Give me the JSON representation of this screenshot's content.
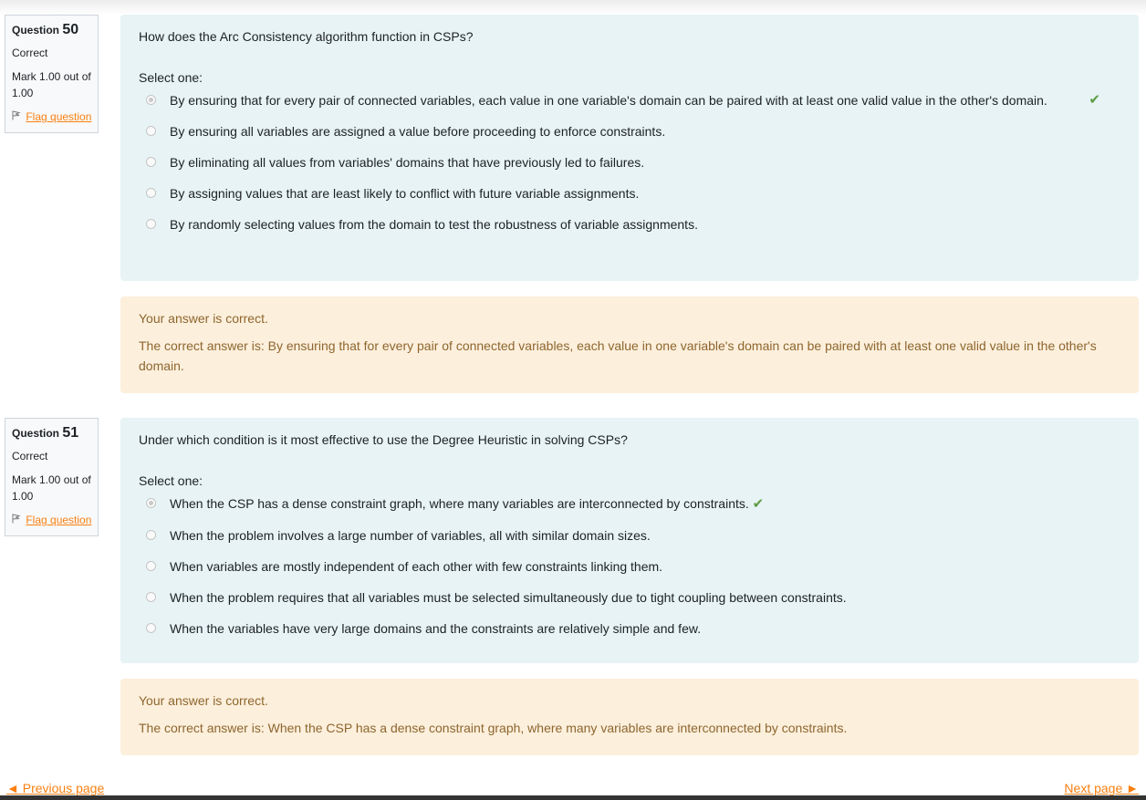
{
  "questions": [
    {
      "label": "Question",
      "number": "50",
      "state": "Correct",
      "grade": "Mark 1.00 out of 1.00",
      "flag": "Flag question",
      "text": "How does the Arc Consistency algorithm function in CSPs?",
      "prompt": "Select one:",
      "options": [
        "By ensuring that for every pair of connected variables, each value in one variable's domain can be paired with at least one valid value in the other's domain.",
        "By ensuring all variables are assigned a value before proceeding to enforce constraints.",
        "By eliminating all values from variables' domains that have previously led to failures.",
        "By assigning values that are least likely to conflict with future variable assignments.",
        "By randomly selecting values from the domain to test the robustness of variable assignments."
      ],
      "feedback": "Your answer is correct.",
      "right_answer": "The correct answer is: By ensuring that for every pair of connected variables, each value in one variable's domain can be paired with at least one valid value in the other's domain."
    },
    {
      "label": "Question",
      "number": "51",
      "state": "Correct",
      "grade": "Mark 1.00 out of 1.00",
      "flag": "Flag question",
      "text": "Under which condition is it most effective to use the Degree Heuristic in solving CSPs?",
      "prompt": "Select one:",
      "options": [
        "When the CSP has a dense constraint graph, where many variables are interconnected by constraints.",
        "When the problem involves a large number of variables, all with similar domain sizes.",
        "When variables are mostly independent of each other with few constraints linking them.",
        "When the problem requires that all variables must be selected simultaneously due to tight coupling between constraints.",
        "When the variables have very large domains and the constraints are relatively simple and few."
      ],
      "feedback": "Your answer is correct.",
      "right_answer": "The correct answer is: When the CSP has a dense constraint graph, where many variables are interconnected by constraints."
    }
  ],
  "nav": {
    "previous": "◄ Previous page",
    "next": "Next page ►"
  },
  "icons": {
    "check": "check-icon",
    "flag": "flag-icon"
  },
  "colors": {
    "formulation_bg": "#e7f3f5",
    "feedback_bg": "#fcefdc",
    "feedback_text": "#8e662e",
    "link": "#f98012",
    "correct_tick": "#5c9b44"
  }
}
